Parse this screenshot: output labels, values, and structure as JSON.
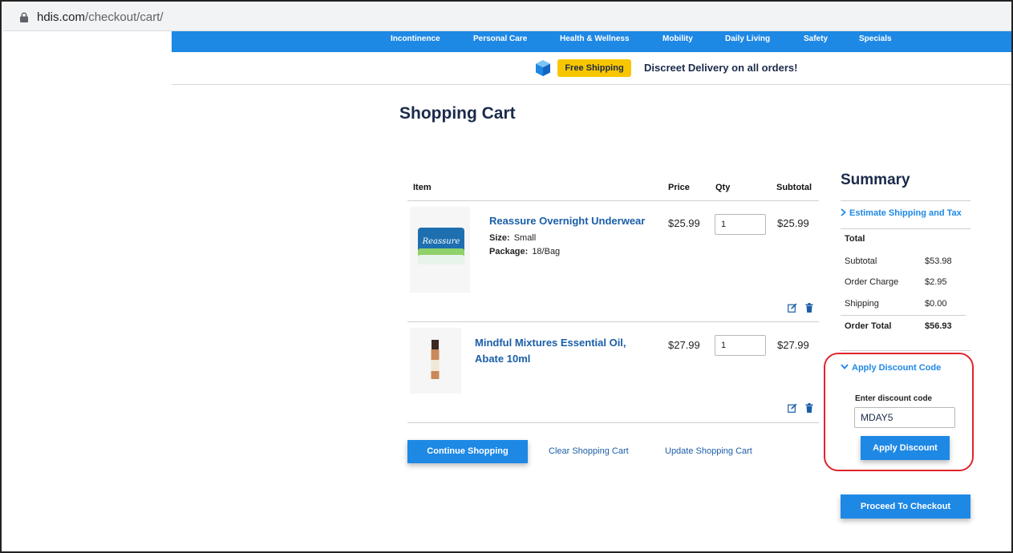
{
  "browser": {
    "url_host": "hdis.com",
    "url_path": "/checkout/cart/"
  },
  "nav": {
    "items": [
      "Incontinence",
      "Personal Care",
      "Health & Wellness",
      "Mobility",
      "Daily Living",
      "Safety",
      "Specials"
    ]
  },
  "banner": {
    "badge": "Free Shipping",
    "text": "Discreet Delivery on all orders!"
  },
  "page_title": "Shopping Cart",
  "cart": {
    "headers": {
      "item": "Item",
      "price": "Price",
      "qty": "Qty",
      "subtotal": "Subtotal"
    },
    "items": [
      {
        "name": "Reassure Overnight Underwear",
        "size_label": "Size:",
        "size": "Small",
        "package_label": "Package:",
        "package": "18/Bag",
        "price": "$25.99",
        "qty": "1",
        "subtotal": "$25.99",
        "img_brand": "Reassure"
      },
      {
        "name": "Mindful Mixtures Essential Oil, Abate 10ml",
        "price": "$27.99",
        "qty": "1",
        "subtotal": "$27.99"
      }
    ],
    "actions": {
      "continue": "Continue Shopping",
      "clear": "Clear Shopping Cart",
      "update": "Update Shopping Cart"
    }
  },
  "summary": {
    "title": "Summary",
    "estimate_link": "Estimate Shipping and Tax",
    "total_heading": "Total",
    "rows": [
      {
        "label": "Subtotal",
        "value": "$53.98"
      },
      {
        "label": "Order Charge",
        "value": "$2.95"
      },
      {
        "label": "Shipping",
        "value": "$0.00"
      }
    ],
    "order_total": {
      "label": "Order Total",
      "value": "$56.93"
    },
    "discount": {
      "toggle": "Apply Discount Code",
      "label": "Enter discount code",
      "value": "MDAY5",
      "button": "Apply Discount"
    },
    "checkout": "Proceed To Checkout"
  },
  "colors": {
    "brand_blue": "#1e88e5",
    "navy": "#1b2a4a",
    "link": "#1a5ea8",
    "badge": "#f7c600",
    "highlight": "#e0242e"
  }
}
